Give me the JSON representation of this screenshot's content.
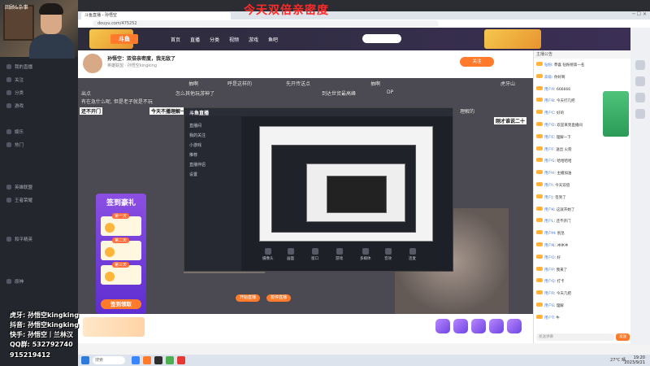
{
  "overlay_title": "今天双倍亲密度",
  "webcam": {
    "label": "回顾&杂事"
  },
  "streamer_ids": [
    "虎牙: 孙悟空kingking",
    "抖音: 孙悟空kingking",
    "快手: 孙悟空丨兰林汉",
    "QQ群: 532792740",
    "915219412"
  ],
  "left_sidebar": [
    "我的直播",
    "关注",
    "分类",
    "游戏",
    "娱乐",
    "热门",
    "英雄联盟",
    "王者荣耀",
    "和平精英",
    "原神"
  ],
  "browser": {
    "tab_title": "斗鱼直播 - 孙悟空",
    "url": "douyu.com/475252"
  },
  "site_nav": {
    "home": "首页",
    "live": "直播",
    "category": "分类",
    "video": "视频",
    "game": "游戏",
    "fish": "鱼吧",
    "search_placeholder": ""
  },
  "room": {
    "title": "孙悟空：双倍亲密度，我无敌了",
    "subtitle": "英雄联盟 · 孙悟空kingking",
    "follow": "关注"
  },
  "danmu": [
    "抽啊",
    "呼是这样的",
    "先开传送点",
    "抽啊",
    "虎牙山",
    "出点",
    "怎么其他玩游神了",
    "到达世贸最高峰",
    "DP",
    "还不开门",
    "今天不播理解一",
    "刚才谁说二十",
    "理解的",
    "有在急什么呢, 但是老子就是不玩"
  ],
  "inner_app": {
    "brand": "斗鱼直播",
    "left_items": [
      "直播间",
      "我的关注",
      "小游戏",
      "推荐",
      "直播伴侣",
      "设置"
    ],
    "tools": [
      "摄像头",
      "画面",
      "窗口",
      "游戏",
      "多媒体",
      "音效",
      "连麦"
    ],
    "button_a": "开始直播",
    "button_b": "暂停直播"
  },
  "signin": {
    "title": "签到豪礼",
    "days": [
      "第一天",
      "第二天",
      "第三天"
    ],
    "cta": "签到领取"
  },
  "chat": {
    "header": "主播公告",
    "lines": [
      {
        "user": "钻粉",
        "text": "恭喜 钻粉榜第一名"
      },
      {
        "user": "高级",
        "text": "你好啊"
      },
      {
        "user": "用户A",
        "text": "666666"
      },
      {
        "user": "用户B",
        "text": "今天打几把"
      },
      {
        "user": "用户C",
        "text": "好的"
      },
      {
        "user": "用户D",
        "text": "欢迎来到直播间"
      },
      {
        "user": "用户E",
        "text": "理解一下"
      },
      {
        "user": "用户F",
        "text": "送出 火箭"
      },
      {
        "user": "用户G",
        "text": "哈哈哈哈"
      },
      {
        "user": "用户H",
        "text": "主播加油"
      },
      {
        "user": "用户I",
        "text": "今天双倍"
      },
      {
        "user": "用户J",
        "text": "签到了"
      },
      {
        "user": "用户K",
        "text": "这就开始了"
      },
      {
        "user": "用户L",
        "text": "还不开门"
      },
      {
        "user": "用户M",
        "text": "别急"
      },
      {
        "user": "用户N",
        "text": "冲冲冲"
      },
      {
        "user": "用户O",
        "text": "好"
      },
      {
        "user": "用户P",
        "text": "我来了"
      },
      {
        "user": "用户Q",
        "text": "打卡"
      },
      {
        "user": "用户R",
        "text": "今天几把"
      },
      {
        "user": "用户S",
        "text": "理解"
      },
      {
        "user": "用户T",
        "text": "牛"
      }
    ],
    "input_placeholder": "发送弹幕",
    "send": "发送"
  },
  "taskbar": {
    "search": "搜索",
    "tray": "27°C 晴",
    "time": "19:20",
    "date": "2023/9/21"
  }
}
